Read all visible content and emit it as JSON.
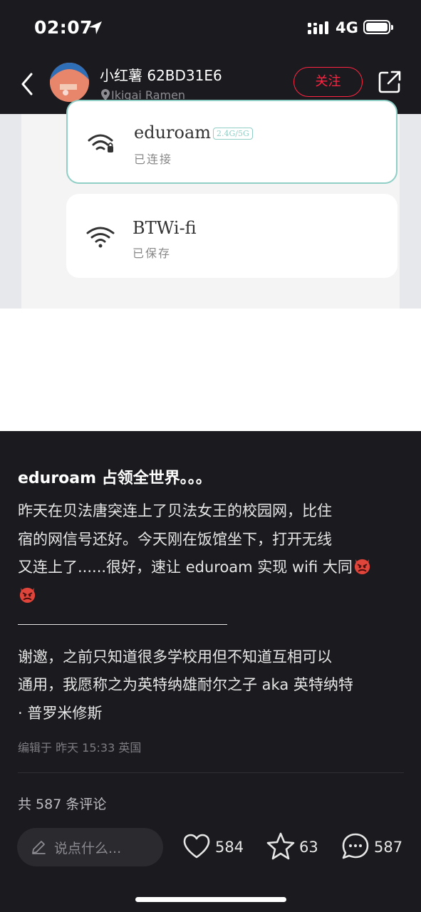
{
  "status_bar": {
    "time": "02:07",
    "network": "4G"
  },
  "header": {
    "username": "小红薯 62BD31E6",
    "location": "Ikigai Ramen",
    "follow_label": "关注"
  },
  "image": {
    "networks": [
      {
        "ssid": "eduroam",
        "band": "2.4G/5G",
        "status": "已连接"
      },
      {
        "ssid": "BTWi-fi",
        "status": "已保存"
      }
    ]
  },
  "post": {
    "title": "eduroam 占领全世界。。。",
    "body_line1": "昨天在贝法唐突连上了贝法女王的校园网，比住",
    "body_line2": "宿的网信号还好。今天刚在饭馆坐下，打开无线",
    "body_line3": "又连上了......很好，速让 eduroam 实现 wifi 大同",
    "divider": "——————————————",
    "body_line5": "谢邀，之前只知道很多学校用但不知道互相可以",
    "body_line6": "通用，我愿称之为英特纳雄耐尔之子 aka 英特纳特",
    "body_line7": "· 普罗米修斯",
    "edit_meta": "编辑于 昨天 15:33 英国",
    "comment_count": "共 587 条评论"
  },
  "action_bar": {
    "comment_placeholder": "说点什么...",
    "likes": "584",
    "stars": "63",
    "comments": "587"
  },
  "colors": {
    "background": "#1b1b1f",
    "accent": "#ff2442",
    "wifi_connected_border": "#8fcfc6"
  }
}
